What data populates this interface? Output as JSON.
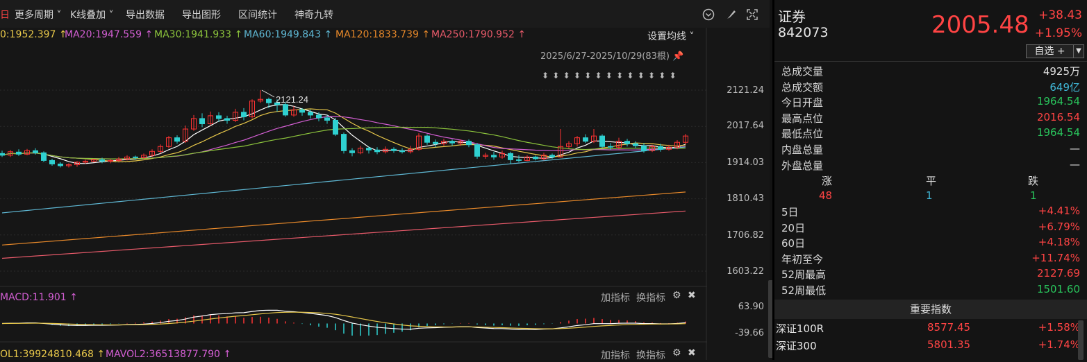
{
  "toolbar": {
    "period": "日",
    "more_periods": "更多周期 ˅",
    "kline_overlay": "K线叠加 ˅",
    "export_data": "导出数据",
    "export_chart": "导出图形",
    "range_stats": "区间统计",
    "magic_nine": "神奇九转"
  },
  "ma_legend": {
    "ma10": "0:1952.397 ↑",
    "ma20": "MA20:1947.559 ↑",
    "ma30": "MA30:1941.933 ↑",
    "ma60": "MA60:1949.843 ↑",
    "ma120": "MA120:1833.739 ↑",
    "ma250": "MA250:1790.952 ↑",
    "settings": "设置均线 ˅"
  },
  "chart": {
    "range": "2025/6/27-2025/10/29(83根)",
    "peak_label": "2121.24",
    "colors": {
      "up": "#ff3333",
      "down": "#2fd0d0",
      "ma10": "#ffffff",
      "ma20": "#e8c84a",
      "ma30": "#d45fd4",
      "ma60": "#8cc43c",
      "ma120": "#5fb8d4",
      "ma250": "#e8892a",
      "ma_long": "#e85a6a"
    }
  },
  "axis": {
    "ticks": [
      "2121.24",
      "2017.64",
      "1914.03",
      "1810.43",
      "1706.82",
      "1603.22"
    ],
    "macd_ticks": [
      "63.90",
      "-39.66"
    ]
  },
  "macd": {
    "label": "MACD:11.901 ↑",
    "add": "加指标",
    "switch": "换指标"
  },
  "vol": {
    "mavol1": "OL1:39924810.468 ↑",
    "mavol2": "MAVOL2:36513877.790 ↑",
    "add": "加指标",
    "switch": "换指标"
  },
  "quote": {
    "name": "证券",
    "code": "842073",
    "price": "2005.48",
    "change": "+38.43",
    "change_pct": "+1.95%",
    "watchlist_label": "自选 +"
  },
  "stats": [
    {
      "label": "总成交量",
      "value": "4925万",
      "color": "white"
    },
    {
      "label": "总成交额",
      "value": "649亿",
      "color": "cyan"
    },
    {
      "label": "今日开盘",
      "value": "1964.54",
      "color": "green"
    },
    {
      "label": "最高点位",
      "value": "2016.54",
      "color": "red"
    },
    {
      "label": "最低点位",
      "value": "1964.54",
      "color": "green"
    },
    {
      "label": "内盘总量",
      "value": "—",
      "color": "white"
    },
    {
      "label": "外盘总量",
      "value": "—",
      "color": "white"
    }
  ],
  "breadth": {
    "up_label": "涨",
    "flat_label": "平",
    "down_label": "跌",
    "up": "48",
    "flat": "1",
    "down": "1"
  },
  "periods": [
    {
      "label": "5日",
      "value": "+4.41%"
    },
    {
      "label": "20日",
      "value": "+6.79%"
    },
    {
      "label": "60日",
      "value": "+4.18%"
    },
    {
      "label": "年初至今",
      "value": "+11.74%"
    },
    {
      "label": "52周最高",
      "value": "2127.69"
    },
    {
      "label": "52周最低",
      "value": "1501.60"
    }
  ],
  "indices": {
    "header": "重要指数",
    "rows": [
      {
        "name": "深证100R",
        "price": "8577.45",
        "change": "+1.58%"
      },
      {
        "name": "深证300",
        "price": "5801.35",
        "change": "+1.74%"
      }
    ]
  },
  "chart_data": {
    "type": "candlestick",
    "price_range": [
      1603.22,
      2121.24
    ],
    "candles": [
      [
        1940,
        1935,
        1948,
        1930
      ],
      [
        1935,
        1945,
        1950,
        1930
      ],
      [
        1944,
        1938,
        1952,
        1933
      ],
      [
        1938,
        1948,
        1953,
        1935
      ],
      [
        1948,
        1942,
        1955,
        1937
      ],
      [
        1942,
        1920,
        1946,
        1915
      ],
      [
        1920,
        1910,
        1925,
        1905
      ],
      [
        1910,
        1905,
        1915,
        1900
      ],
      [
        1905,
        1908,
        1912,
        1900
      ],
      [
        1908,
        1915,
        1918,
        1902
      ],
      [
        1915,
        1918,
        1922,
        1910
      ],
      [
        1918,
        1922,
        1925,
        1915
      ],
      [
        1922,
        1918,
        1928,
        1912
      ],
      [
        1918,
        1920,
        1924,
        1912
      ],
      [
        1920,
        1924,
        1930,
        1916
      ],
      [
        1924,
        1930,
        1935,
        1920
      ],
      [
        1930,
        1928,
        1934,
        1922
      ],
      [
        1928,
        1935,
        1940,
        1925
      ],
      [
        1935,
        1946,
        1952,
        1930
      ],
      [
        1946,
        1960,
        1966,
        1940
      ],
      [
        1960,
        1985,
        1990,
        1955
      ],
      [
        1985,
        1975,
        1992,
        1968
      ],
      [
        1975,
        2010,
        2020,
        1970
      ],
      [
        2010,
        2040,
        2050,
        2005
      ],
      [
        2040,
        2025,
        2055,
        2015
      ],
      [
        2025,
        2048,
        2060,
        2020
      ],
      [
        2048,
        2040,
        2058,
        2030
      ],
      [
        2040,
        2035,
        2048,
        2025
      ],
      [
        2035,
        2058,
        2068,
        2030
      ],
      [
        2058,
        2045,
        2070,
        2035
      ],
      [
        2045,
        2090,
        2095,
        2040
      ],
      [
        2090,
        2095,
        2121,
        2085
      ],
      [
        2095,
        2085,
        2100,
        2070
      ],
      [
        2085,
        2080,
        2095,
        2060
      ],
      [
        2080,
        2050,
        2088,
        2045
      ],
      [
        2050,
        2065,
        2075,
        2045
      ],
      [
        2065,
        2058,
        2070,
        2048
      ],
      [
        2058,
        2050,
        2065,
        2040
      ],
      [
        2050,
        2042,
        2058,
        2032
      ],
      [
        2042,
        2035,
        2050,
        2025
      ],
      [
        2035,
        1995,
        2042,
        1990
      ],
      [
        1995,
        1948,
        2000,
        1940
      ],
      [
        1948,
        1942,
        1955,
        1932
      ],
      [
        1942,
        1955,
        1962,
        1938
      ],
      [
        1955,
        1950,
        1960,
        1940
      ],
      [
        1950,
        1945,
        1958,
        1938
      ],
      [
        1945,
        1952,
        1960,
        1940
      ],
      [
        1952,
        1948,
        1958,
        1942
      ],
      [
        1948,
        1945,
        1955,
        1940
      ],
      [
        1945,
        1952,
        1962,
        1940
      ],
      [
        1952,
        1990,
        1998,
        1948
      ],
      [
        1990,
        1972,
        1995,
        1965
      ],
      [
        1972,
        1968,
        1980,
        1958
      ],
      [
        1968,
        1975,
        1982,
        1962
      ],
      [
        1975,
        1970,
        1980,
        1962
      ],
      [
        1970,
        1975,
        1980,
        1962
      ],
      [
        1975,
        1965,
        1980,
        1958
      ],
      [
        1965,
        1932,
        1970,
        1925
      ],
      [
        1932,
        1935,
        1942,
        1925
      ],
      [
        1935,
        1930,
        1945,
        1922
      ],
      [
        1930,
        1940,
        1948,
        1925
      ],
      [
        1940,
        1922,
        1945,
        1910
      ],
      [
        1922,
        1920,
        1935,
        1915
      ],
      [
        1920,
        1930,
        1935,
        1918
      ],
      [
        1930,
        1925,
        1934,
        1920
      ],
      [
        1925,
        1935,
        1942,
        1920
      ],
      [
        1935,
        1930,
        1940,
        1925
      ],
      [
        1930,
        1960,
        2010,
        1928
      ],
      [
        1960,
        1968,
        1975,
        1955
      ],
      [
        1968,
        1985,
        1990,
        1960
      ],
      [
        1985,
        1975,
        1995,
        1970
      ],
      [
        1975,
        1990,
        2010,
        1970
      ],
      [
        1990,
        1960,
        1995,
        1955
      ],
      [
        1960,
        1958,
        1970,
        1950
      ],
      [
        1958,
        1975,
        1985,
        1952
      ],
      [
        1975,
        1968,
        1982,
        1960
      ],
      [
        1968,
        1962,
        1975,
        1955
      ],
      [
        1962,
        1948,
        1970,
        1942
      ],
      [
        1948,
        1960,
        1965,
        1944
      ],
      [
        1960,
        1952,
        1968,
        1945
      ],
      [
        1952,
        1958,
        1965,
        1948
      ],
      [
        1958,
        1972,
        1978,
        1952
      ],
      [
        1972,
        1990,
        1996,
        1966
      ]
    ]
  }
}
